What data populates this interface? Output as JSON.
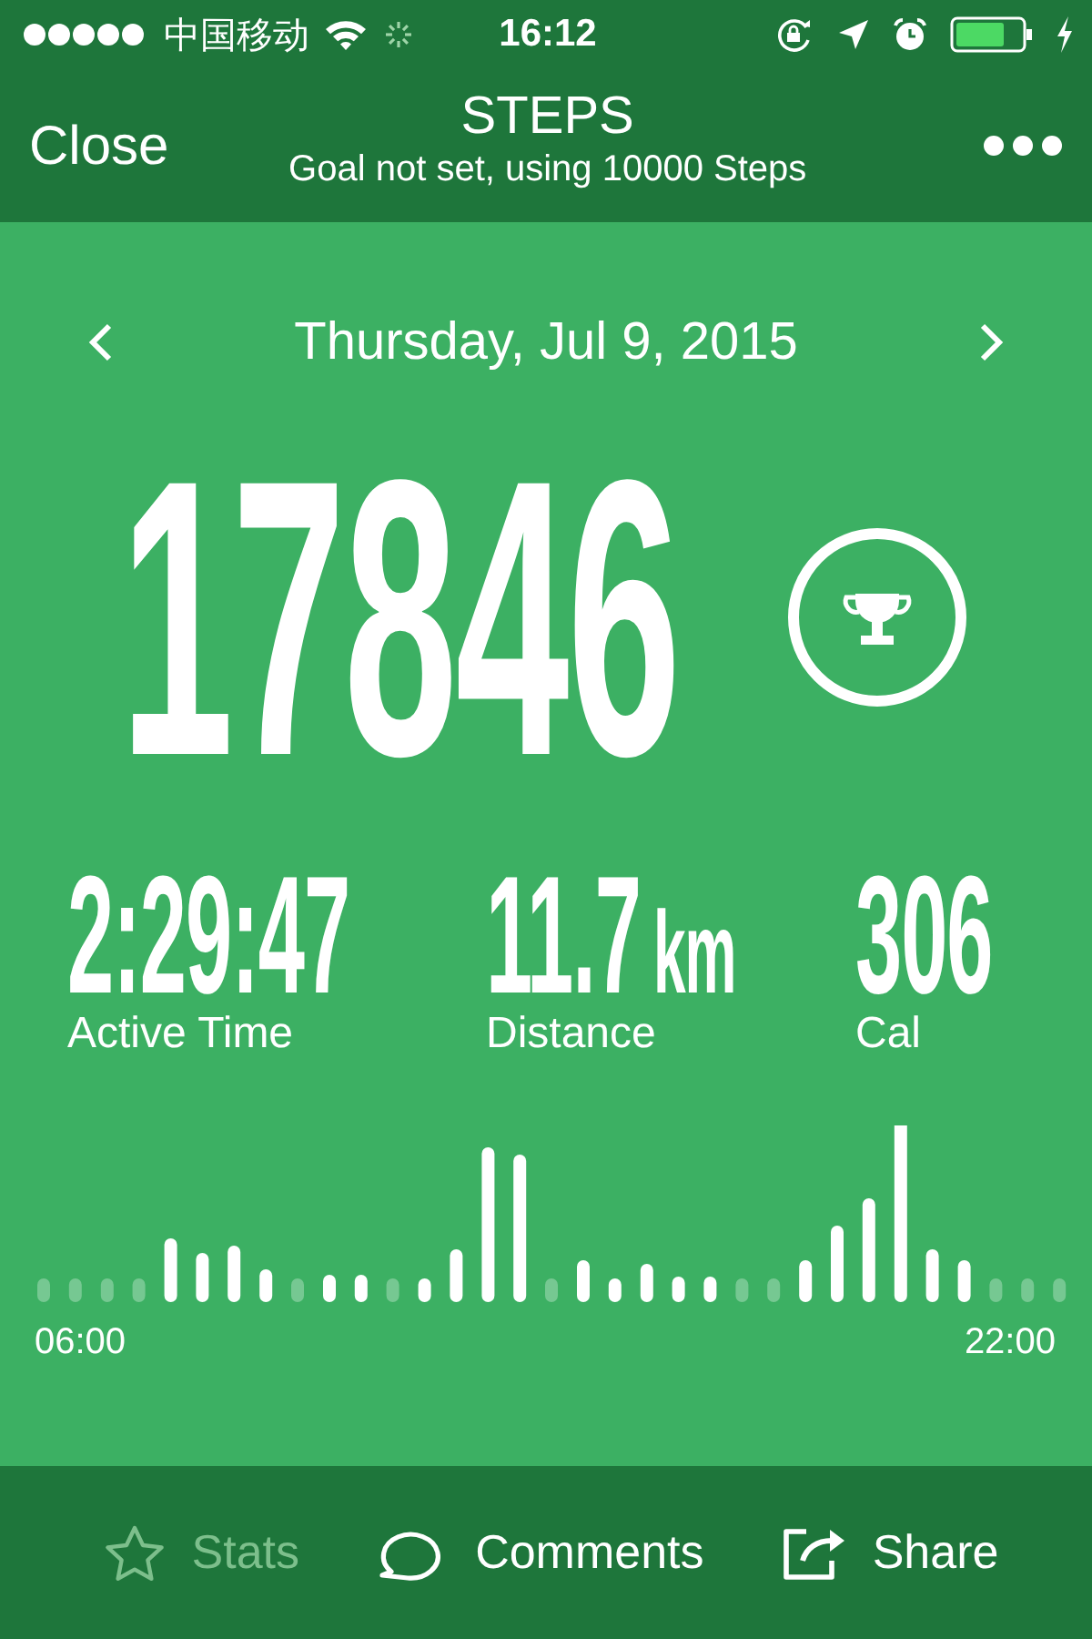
{
  "status_bar": {
    "carrier": "中国移动",
    "time": "16:12"
  },
  "nav": {
    "close": "Close",
    "title": "STEPS",
    "subtitle": "Goal not set, using 10000 Steps"
  },
  "date": "Thursday, Jul 9, 2015",
  "steps": "17846",
  "metrics": [
    {
      "value": "2:29:47",
      "label": "Active Time"
    },
    {
      "value": "11.7",
      "unit": "km",
      "label": "Distance"
    },
    {
      "value": "306",
      "label": "Cal"
    }
  ],
  "chart": {
    "start_label": "06:00",
    "end_label": "22:00"
  },
  "tabs": [
    {
      "kind": "star",
      "label": "Stats",
      "disabled": true
    },
    {
      "kind": "comment",
      "label": "Comments",
      "disabled": false
    },
    {
      "kind": "share",
      "label": "Share",
      "disabled": false
    }
  ]
}
